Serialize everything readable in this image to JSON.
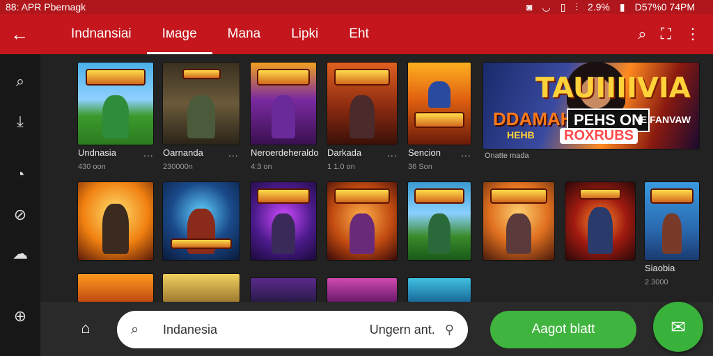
{
  "status_bar": {
    "left_text": "88: APR Pbernagk",
    "battery_text": "2.9%",
    "time_text": "D57%0 74PM"
  },
  "app_bar": {
    "tabs": [
      {
        "label": "Indnansiai"
      },
      {
        "label": "Iмage",
        "active": true
      },
      {
        "label": "Mana"
      },
      {
        "label": "Lipki"
      },
      {
        "label": "Eht"
      }
    ]
  },
  "colors": {
    "accent": "#c4161c",
    "green": "#3fb43e"
  },
  "row1": [
    {
      "title": "Undnasia",
      "sub": "430 oon",
      "dots": "..."
    },
    {
      "title": "Oarnanda",
      "sub": "230000n",
      "dots": "..."
    },
    {
      "title": "Neroerdeheraldo",
      "sub": "4:3 on",
      "dots": ""
    },
    {
      "title": "Darkada",
      "sub": "1 1.0 on",
      "dots": "..."
    },
    {
      "title": "Sencion",
      "sub": "36 Son",
      "dots": "..."
    }
  ],
  "hero": {
    "title": "TAUIIIIVIA",
    "line1": "DDAMAH",
    "line2": "PEHS ON",
    "line3": "IE FANVAW",
    "line4": "HEHB",
    "line5": "ROXRUBS",
    "caption": "Onatte mada",
    "dots": "..."
  },
  "row2": [
    {
      "title": "",
      "sub": ""
    },
    {
      "title": "",
      "sub": ""
    },
    {
      "title": "",
      "sub": ""
    },
    {
      "title": "",
      "sub": ""
    },
    {
      "title": "",
      "sub": ""
    },
    {
      "title": "",
      "sub": ""
    },
    {
      "title": "",
      "sub": ""
    },
    {
      "title": "Siaobia",
      "sub": "2 3000"
    }
  ],
  "bottom_bar": {
    "search_value": "Indanesia",
    "search_hint": "Ungern ant.",
    "action_button": "Aagot blatt"
  }
}
